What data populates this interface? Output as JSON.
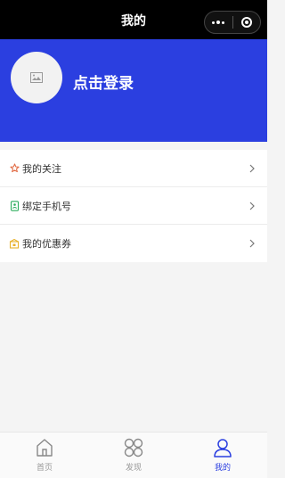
{
  "navbar": {
    "title": "我的",
    "more_icon": "more-dots-icon",
    "close_icon": "target-circle-icon"
  },
  "header": {
    "background": "#2b3fe0",
    "avatar_icon": "image-placeholder-icon",
    "login_text": "点击登录"
  },
  "menu": {
    "items": [
      {
        "label": "我的关注",
        "icon": "star-icon"
      },
      {
        "label": "绑定手机号",
        "icon": "phone-icon"
      },
      {
        "label": "我的优惠券",
        "icon": "coupon-icon"
      }
    ]
  },
  "tabbar": {
    "accent": "#2b3fe0",
    "tabs": [
      {
        "label": "首页",
        "icon": "home-icon",
        "active": false
      },
      {
        "label": "发现",
        "icon": "discover-grid-icon",
        "active": false
      },
      {
        "label": "我的",
        "icon": "user-icon",
        "active": true
      }
    ]
  }
}
